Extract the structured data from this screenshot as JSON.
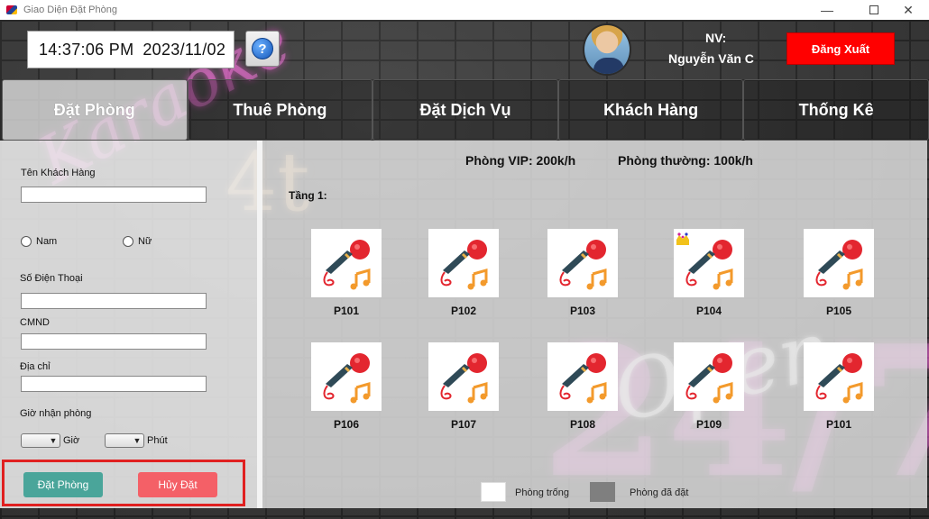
{
  "window": {
    "title": "Giao Diện Đặt Phòng",
    "minimize": "—",
    "close": "✕"
  },
  "header": {
    "time": "14:37:06 PM",
    "date": "2023/11/02",
    "help_label": "?",
    "nv_label": "NV:",
    "nv_name": "Nguyễn Văn C",
    "logout_label": "Đăng Xuất"
  },
  "tabs": [
    {
      "label": "Đặt Phòng",
      "active": true
    },
    {
      "label": "Thuê Phòng",
      "active": false
    },
    {
      "label": "Đặt Dịch Vụ",
      "active": false
    },
    {
      "label": "Khách Hàng",
      "active": false
    },
    {
      "label": "Thống Kê",
      "active": false
    }
  ],
  "form": {
    "customer_name_label": "Tên Khách Hàng",
    "gender_male": "Nam",
    "gender_female": "Nữ",
    "phone_label": "Số Điện Thoại",
    "id_label": "CMND",
    "address_label": "Địa chỉ",
    "checkin_label": "Giờ nhận phòng",
    "hour_label": "Giờ",
    "minute_label": "Phút",
    "book_label": "Đặt Phòng",
    "cancel_label": "Hủy Đặt"
  },
  "pricing": {
    "vip": "Phòng VIP: 200k/h",
    "normal": "Phòng thường: 100k/h"
  },
  "floor_label": "Tầng 1:",
  "rooms": [
    {
      "name": "P101",
      "vip": false
    },
    {
      "name": "P102",
      "vip": false
    },
    {
      "name": "P103",
      "vip": false
    },
    {
      "name": "P104",
      "vip": true
    },
    {
      "name": "P105",
      "vip": false
    },
    {
      "name": "P106",
      "vip": false
    },
    {
      "name": "P107",
      "vip": false
    },
    {
      "name": "P108",
      "vip": false
    },
    {
      "name": "P109",
      "vip": false
    },
    {
      "name": "P101",
      "vip": false
    }
  ],
  "legend": {
    "empty_label": "Phòng trống",
    "booked_label": "Phòng đã đặt",
    "empty_color": "#ffffff",
    "booked_color": "#7f7f7f"
  },
  "decor": {
    "neon_karaoke": "Karaoke",
    "neon_4t": "4t",
    "neon_open": "Open",
    "neon_247": "24/7"
  },
  "colors": {
    "logout": "#ff0000",
    "book_button": "#4aa59a",
    "cancel_button": "#f46067",
    "highlight_border": "#e02020"
  }
}
